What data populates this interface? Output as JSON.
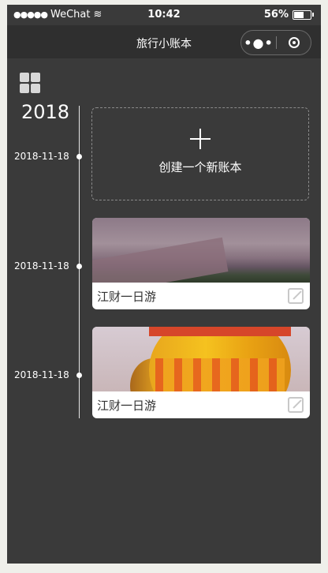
{
  "status": {
    "signal": "●●●●●",
    "carrier": "WeChat",
    "wifi": "≋",
    "time": "10:42",
    "battery_pct": "56%",
    "battery_level": 0.56
  },
  "navbar": {
    "title": "旅行小账本",
    "more": "•●•"
  },
  "year": "2018",
  "new_entry": {
    "date": "2018-11-18",
    "label": "创建一个新账本"
  },
  "books": [
    {
      "date": "2018-11-18",
      "title": "江财一日游"
    },
    {
      "date": "2018-11-18",
      "title": "江财一日游"
    }
  ]
}
